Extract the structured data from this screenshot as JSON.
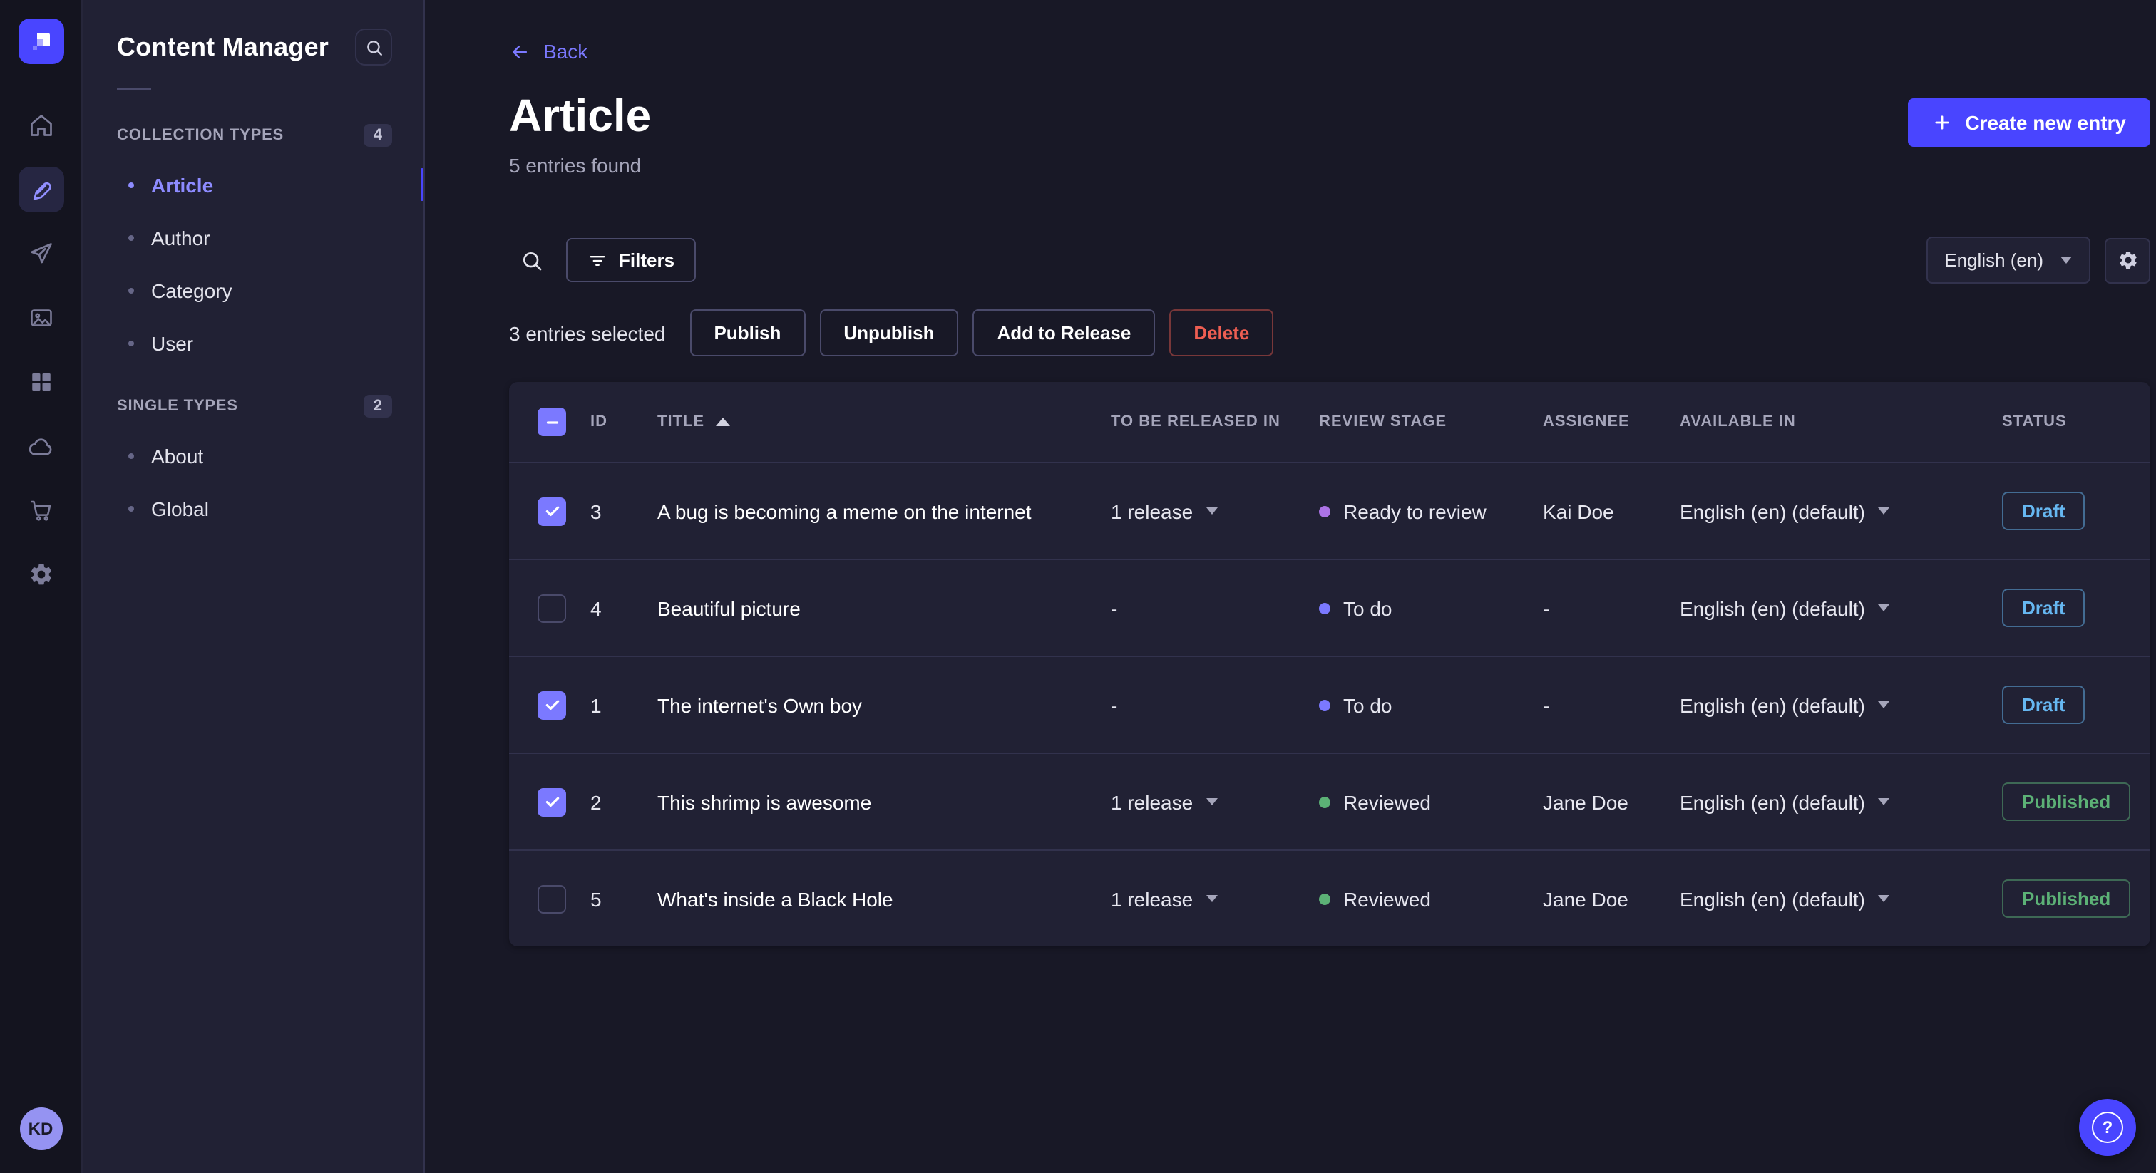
{
  "nav": {
    "logo_icon": "strapi-logo",
    "icons": [
      "home",
      "content-manager",
      "paper-plane",
      "media-library",
      "content-type-builder",
      "cloud",
      "marketplace-cart",
      "settings-gear"
    ],
    "active_icon": "content-manager",
    "avatar_initials": "KD"
  },
  "subnav": {
    "title": "Content Manager",
    "search_icon": "search",
    "sections": [
      {
        "label": "COLLECTION TYPES",
        "badge": "4",
        "items": [
          {
            "label": "Article",
            "active": true
          },
          {
            "label": "Author",
            "active": false
          },
          {
            "label": "Category",
            "active": false
          },
          {
            "label": "User",
            "active": false
          }
        ]
      },
      {
        "label": "SINGLE TYPES",
        "badge": "2",
        "items": [
          {
            "label": "About",
            "active": false
          },
          {
            "label": "Global",
            "active": false
          }
        ]
      }
    ]
  },
  "header": {
    "back_label": "Back",
    "title": "Article",
    "subtitle": "5 entries found",
    "create_button": "Create new entry"
  },
  "toolbar": {
    "search_icon": "search",
    "filters_label": "Filters",
    "locale_selected": "English (en)",
    "settings_icon": "gear"
  },
  "selection": {
    "summary": "3 entries selected",
    "publish": "Publish",
    "unpublish": "Unpublish",
    "add_to_release": "Add to Release",
    "delete": "Delete"
  },
  "table": {
    "select_all_state": "indeterminate",
    "sort": {
      "column": "TITLE",
      "direction": "ascending"
    },
    "columns": [
      "ID",
      "TITLE",
      "TO BE RELEASED IN",
      "REVIEW STAGE",
      "ASSIGNEE",
      "AVAILABLE IN",
      "STATUS"
    ],
    "rows": [
      {
        "check_state": "checked",
        "id": "3",
        "title": "A bug is becoming a meme on the internet",
        "release": "1 release",
        "has_release": true,
        "stage": "Ready to review",
        "stage_color": "#ac73e6",
        "assignee": "Kai Doe",
        "locale": "English (en) (default)",
        "status": "Draft",
        "status_variant": "draft"
      },
      {
        "check_state": "unchecked",
        "id": "4",
        "title": "Beautiful picture",
        "release": "-",
        "has_release": false,
        "stage": "To do",
        "stage_color": "#7b79ff",
        "assignee": "-",
        "locale": "English (en) (default)",
        "status": "Draft",
        "status_variant": "draft"
      },
      {
        "check_state": "checked",
        "id": "1",
        "title": "The internet's Own boy",
        "release": "-",
        "has_release": false,
        "stage": "To do",
        "stage_color": "#7b79ff",
        "assignee": "-",
        "locale": "English (en) (default)",
        "status": "Draft",
        "status_variant": "draft"
      },
      {
        "check_state": "checked",
        "id": "2",
        "title": "This shrimp is awesome",
        "release": "1 release",
        "has_release": true,
        "stage": "Reviewed",
        "stage_color": "#5cb176",
        "assignee": "Jane Doe",
        "locale": "English (en) (default)",
        "status": "Published",
        "status_variant": "published"
      },
      {
        "check_state": "unchecked",
        "id": "5",
        "title": "What's inside a Black Hole",
        "release": "1 release",
        "has_release": true,
        "stage": "Reviewed",
        "stage_color": "#5cb176",
        "assignee": "Jane Doe",
        "locale": "English (en) (default)",
        "status": "Published",
        "status_variant": "published"
      }
    ]
  },
  "help": {
    "icon": "question-mark"
  },
  "colors": {
    "primary": "#4945ff",
    "primary_text": "#7b79ff",
    "draft": "#66b7f1",
    "published": "#5cb176",
    "danger": "#ee5e52",
    "stage_todo": "#7b79ff",
    "stage_ready_to_review": "#ac73e6",
    "stage_reviewed": "#5cb176"
  }
}
